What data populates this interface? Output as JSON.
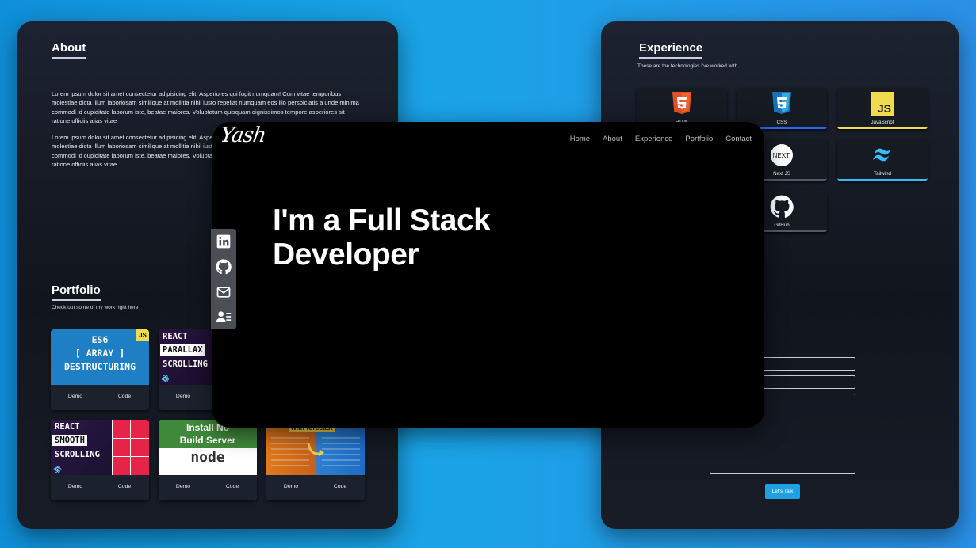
{
  "about": {
    "title": "About",
    "para1": "Lorem ipsum dolor sit amet consectetur adipisicing elit. Asperiores qui fugit numquam! Cum vitae temporibus molestiae dicta illum laboriosam similique at mollitia nihil iusto repellat numquam eos illo perspiciatis a unde minima commodi id cupiditate laborum iste, beatae maiores. Voluptatum quisquam dignissimos tempore asperiores sit ratione officiis alias vitae",
    "para2": "Lorem ipsum dolor sit amet consectetur adipisicing elit. Asperiores qui fugit numquam! Cum vitae temporibus molestiae dicta illum laboriosam similique at mollitia nihil iusto repellat numquam eos illo perspiciatis a unde minima commodi id cupiditate laborum iste, beatae maiores. Voluptatum quisquam dignissimos tempore asperiores sit ratione officiis alias vitae"
  },
  "portfolio": {
    "title": "Portfolio",
    "subtitle": "Check out some of my work right here",
    "demo_label": "Demo",
    "code_label": "Code",
    "projects": [
      {
        "line1": "ES6",
        "line2": "[ ARRAY ]",
        "line3": "DESTRUCTURING",
        "badge": "JS"
      },
      {
        "line1": "REACT",
        "line2": "PARALLAX",
        "line3": "SCROLLING"
      },
      {
        "line1": "REACT",
        "line2": "SMOOTH",
        "line3": "SCROLLING"
      },
      {
        "line1": "Install No",
        "line2": "Build Server",
        "line3": "node"
      },
      {
        "line1": "with forecast"
      }
    ]
  },
  "experience": {
    "title": "Experience",
    "subtitle": "These are the technologies I've worked with",
    "techs": [
      {
        "name": "HTML",
        "icon": "html5-icon"
      },
      {
        "name": "CSS",
        "icon": "css3-icon"
      },
      {
        "name": "JavaScript",
        "icon": "javascript-icon"
      },
      {
        "name": "Next JS",
        "icon": "nextjs-icon"
      },
      {
        "name": "Tailwind",
        "icon": "tailwind-icon"
      },
      {
        "name": "GitHub",
        "icon": "github-icon"
      }
    ]
  },
  "contact": {
    "button_label": "Let's Talk"
  },
  "hero": {
    "logo": "Yash",
    "nav": [
      "Home",
      "About",
      "Experience",
      "Portfolio",
      "Contact"
    ],
    "headline_line1": "I'm a Full Stack",
    "headline_line2": "Developer"
  },
  "social": [
    "linkedin-icon",
    "github-icon",
    "mail-icon",
    "contact-card-icon"
  ],
  "colors": {
    "background": "#1aa3e6",
    "panel": "#161b24",
    "hero": "#000000",
    "social_bar": "#4b4f55",
    "button": "#1ea0e6"
  }
}
